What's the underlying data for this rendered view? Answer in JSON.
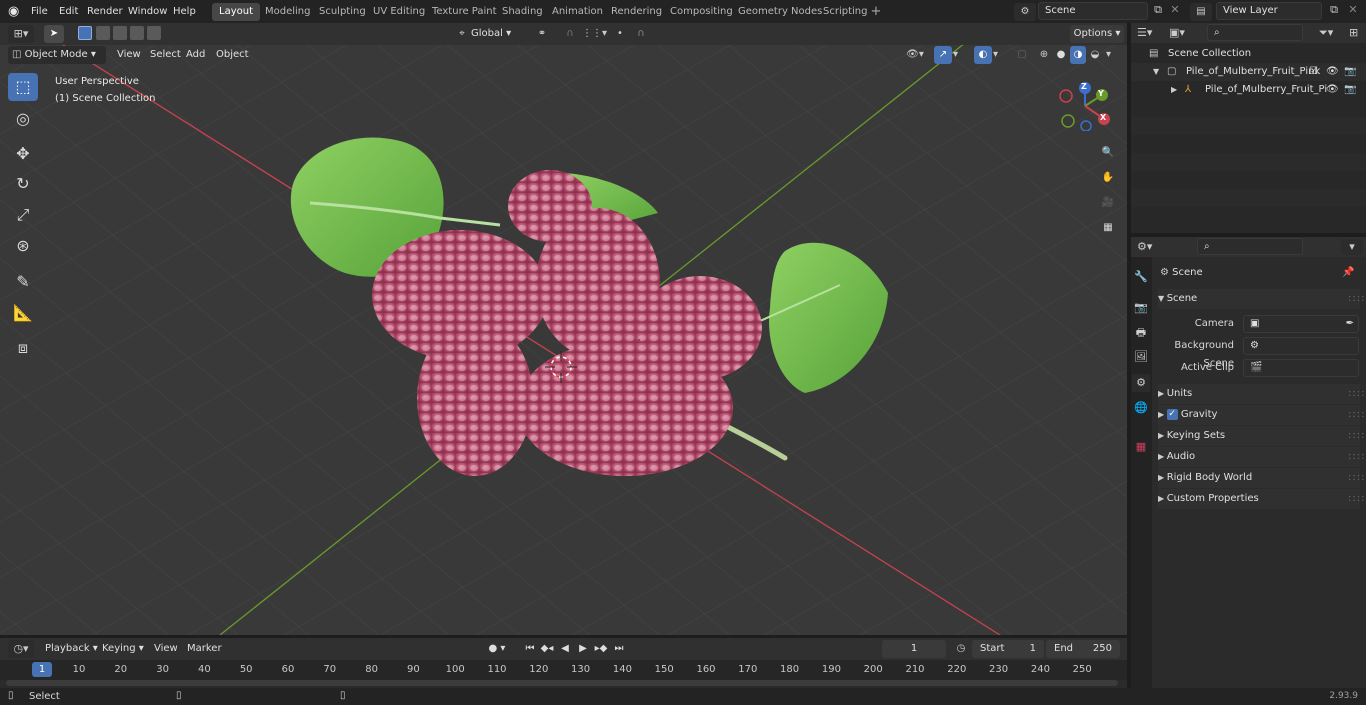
{
  "app": {
    "menus": [
      "File",
      "Edit",
      "Render",
      "Window",
      "Help"
    ],
    "workspaces": [
      "Layout",
      "Modeling",
      "Sculpting",
      "UV Editing",
      "Texture Paint",
      "Shading",
      "Animation",
      "Rendering",
      "Compositing",
      "Geometry Nodes",
      "Scripting"
    ],
    "active_workspace": "Layout",
    "add_workspace": "+",
    "scene_name": "Scene",
    "view_layer": "View Layer"
  },
  "viewport": {
    "mode": "Object Mode",
    "menus": [
      "View",
      "Select",
      "Add",
      "Object"
    ],
    "transform_orientation": "Global",
    "options_label": "Options",
    "info_line1": "User Perspective",
    "info_line2": "(1) Scene Collection",
    "gizmo": {
      "z": "Z",
      "y": "Y",
      "x": "X"
    }
  },
  "outliner": {
    "search_placeholder": "",
    "root": "Scene Collection",
    "items": [
      {
        "label": "Pile_of_Mulberry_Fruit_Pink"
      },
      {
        "label": "Pile_of_Mulberry_Fruit_Pi"
      }
    ]
  },
  "properties": {
    "search_placeholder": "",
    "context": "Scene",
    "section": "Scene",
    "fields": [
      {
        "label": "Camera",
        "value": ""
      },
      {
        "label": "Background Scene",
        "value": ""
      },
      {
        "label": "Active Clip",
        "value": ""
      }
    ],
    "panels": [
      "Units",
      "Gravity",
      "Keying Sets",
      "Audio",
      "Rigid Body World",
      "Custom Properties"
    ],
    "gravity_checked": true
  },
  "timeline": {
    "menus": [
      "Playback",
      "Keying",
      "View",
      "Marker"
    ],
    "current_frame": "1",
    "start_label": "Start",
    "start": "1",
    "end_label": "End",
    "end": "250",
    "ticks": [
      "1",
      "10",
      "20",
      "30",
      "40",
      "50",
      "60",
      "70",
      "80",
      "90",
      "100",
      "110",
      "120",
      "130",
      "140",
      "150",
      "160",
      "170",
      "180",
      "190",
      "200",
      "210",
      "220",
      "230",
      "240",
      "250"
    ]
  },
  "statusbar": {
    "left": "Select",
    "version": "2.93.9"
  },
  "colors": {
    "accent": "#4772b3",
    "x_axis": "#c8424f",
    "y_axis": "#6a9a2a",
    "berry": "#b34a6a",
    "leaf": "#6cb84a"
  }
}
